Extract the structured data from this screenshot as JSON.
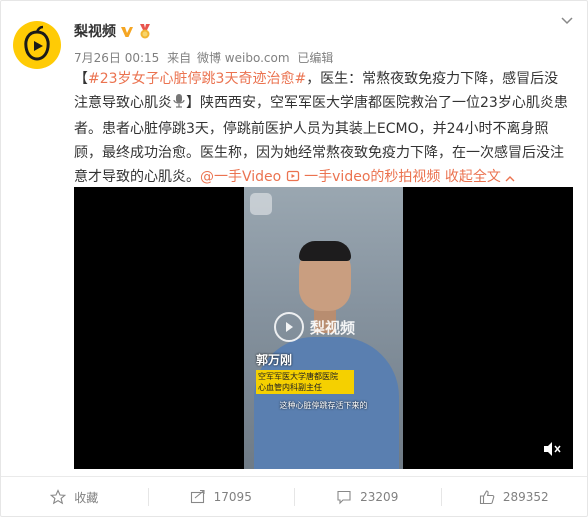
{
  "user": {
    "name": "梨视频",
    "verified_icon": "verified-v-icon",
    "badge_icon": "medal-icon"
  },
  "meta": {
    "date": "7月26日 00:15",
    "from_label": "来自",
    "source": "微博 weibo.com",
    "edited": "已编辑"
  },
  "post": {
    "open_bracket": "【",
    "hashtag": "#23岁女子心脏停跳3天奇迹治愈#",
    "part1": "，医生：常熬夜致免疫力下降，感冒后没注意导致心肌炎",
    "part2": "】陕西西安，空军军医大学唐都医院救治了一位23岁心肌炎患者。患者心脏停跳3天，停跳前医护人员为其装上ECMO，并24小时不离身照顾，最终成功治愈。医生称，因为她经常熬夜致免疫力下降，在一次感冒后没注意才导致的心肌炎。",
    "mention": "@一手Video",
    "video_link": "一手video的秒拍视频",
    "collapse": "收起全文",
    "collapse_icon": "chevron-up-icon"
  },
  "video": {
    "watermark": "梨视频",
    "person_name": "郭万刚",
    "caption_line1": "空军军医大学唐都医院",
    "caption_line2": "心血管内科副主任",
    "subtitle": "这种心脏停跳存活下来的"
  },
  "actions": {
    "favorite": "收藏",
    "repost": "17095",
    "comment": "23209",
    "like": "289352"
  },
  "colors": {
    "link": "#eb7350",
    "avatar_bg": "#FFCB05",
    "caption_bg": "#f5d000"
  }
}
